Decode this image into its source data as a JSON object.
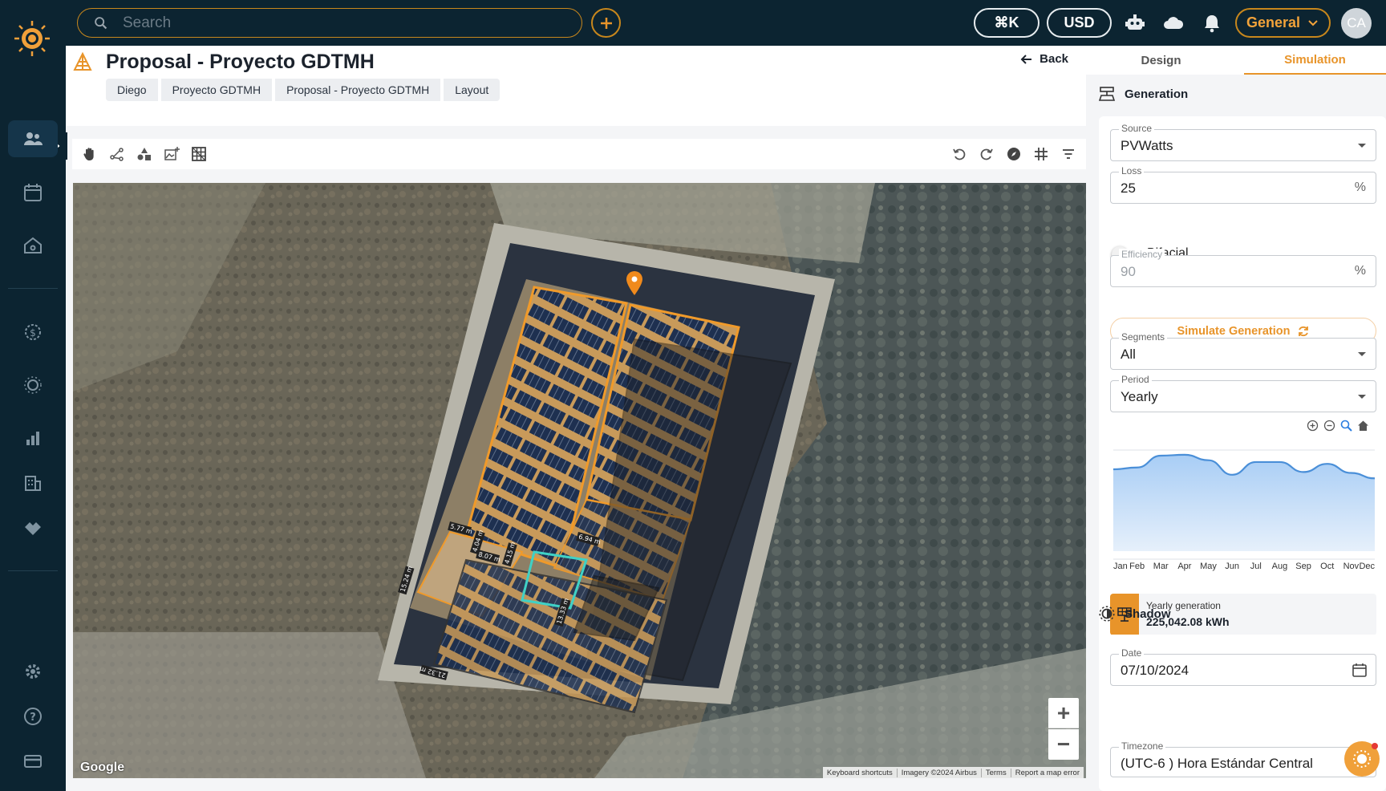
{
  "topbar": {
    "search_placeholder": "Search",
    "cmdk_label": "⌘K",
    "currency_label": "USD",
    "workspace_label": "General",
    "avatar_initials": "CA"
  },
  "page": {
    "title": "Proposal - Proyecto GDTMH",
    "back_label": "Back",
    "breadcrumbs": [
      "Diego",
      "Proyecto GDTMH",
      "Proposal - Proyecto GDTMH",
      "Layout"
    ]
  },
  "map": {
    "watermark": "Google",
    "zoom_in": "+",
    "zoom_out": "−",
    "attribution": [
      "Keyboard shortcuts",
      "Imagery ©2024 Airbus",
      "Terms",
      "Report a map error"
    ],
    "measurements": [
      "5.77 m",
      "8.07 m",
      "4.04 m",
      "4.15 m",
      "6.94 m",
      "15.24 m",
      "13.33 m",
      "21.32 m"
    ]
  },
  "panel": {
    "tabs": [
      "Design",
      "Simulation"
    ],
    "active_tab": "Simulation",
    "generation": {
      "heading": "Generation",
      "source": {
        "label": "Source",
        "value": "PVWatts"
      },
      "loss": {
        "label": "Loss",
        "value": "25",
        "suffix": "%"
      },
      "bifacial_label": "Bifacial",
      "bifacial_on": false,
      "efficiency": {
        "label": "Efficiency",
        "value": "90",
        "suffix": "%"
      },
      "simulate_label": "Simulate Generation",
      "segments": {
        "label": "Segments",
        "value": "All"
      },
      "period": {
        "label": "Period",
        "value": "Yearly"
      },
      "yearly_label": "Yearly generation",
      "yearly_value": "225,042.08 kWh"
    },
    "shadow": {
      "heading": "Shadow",
      "date": {
        "label": "Date",
        "value": "07/10/2024"
      },
      "timezone": {
        "label": "Timezone",
        "value": "(UTC-6 ) Hora Estándar Central"
      }
    }
  },
  "chart_data": {
    "type": "area",
    "categories": [
      "Jan",
      "Feb",
      "Mar",
      "Apr",
      "May",
      "Jun",
      "Jul",
      "Aug",
      "Sep",
      "Oct",
      "Nov",
      "Dec"
    ],
    "values": [
      0.9,
      0.92,
      1.05,
      1.06,
      1.0,
      0.84,
      0.98,
      0.98,
      0.87,
      0.96,
      0.86,
      0.8
    ],
    "ylim": [
      0,
      1.2
    ],
    "grid": true,
    "title": "",
    "xlabel": "",
    "ylabel": ""
  },
  "colors": {
    "accent": "#e8942a",
    "nav_bg": "#0c2431",
    "area_fill": "#a8cdf5",
    "area_line": "#4a8fd8"
  }
}
